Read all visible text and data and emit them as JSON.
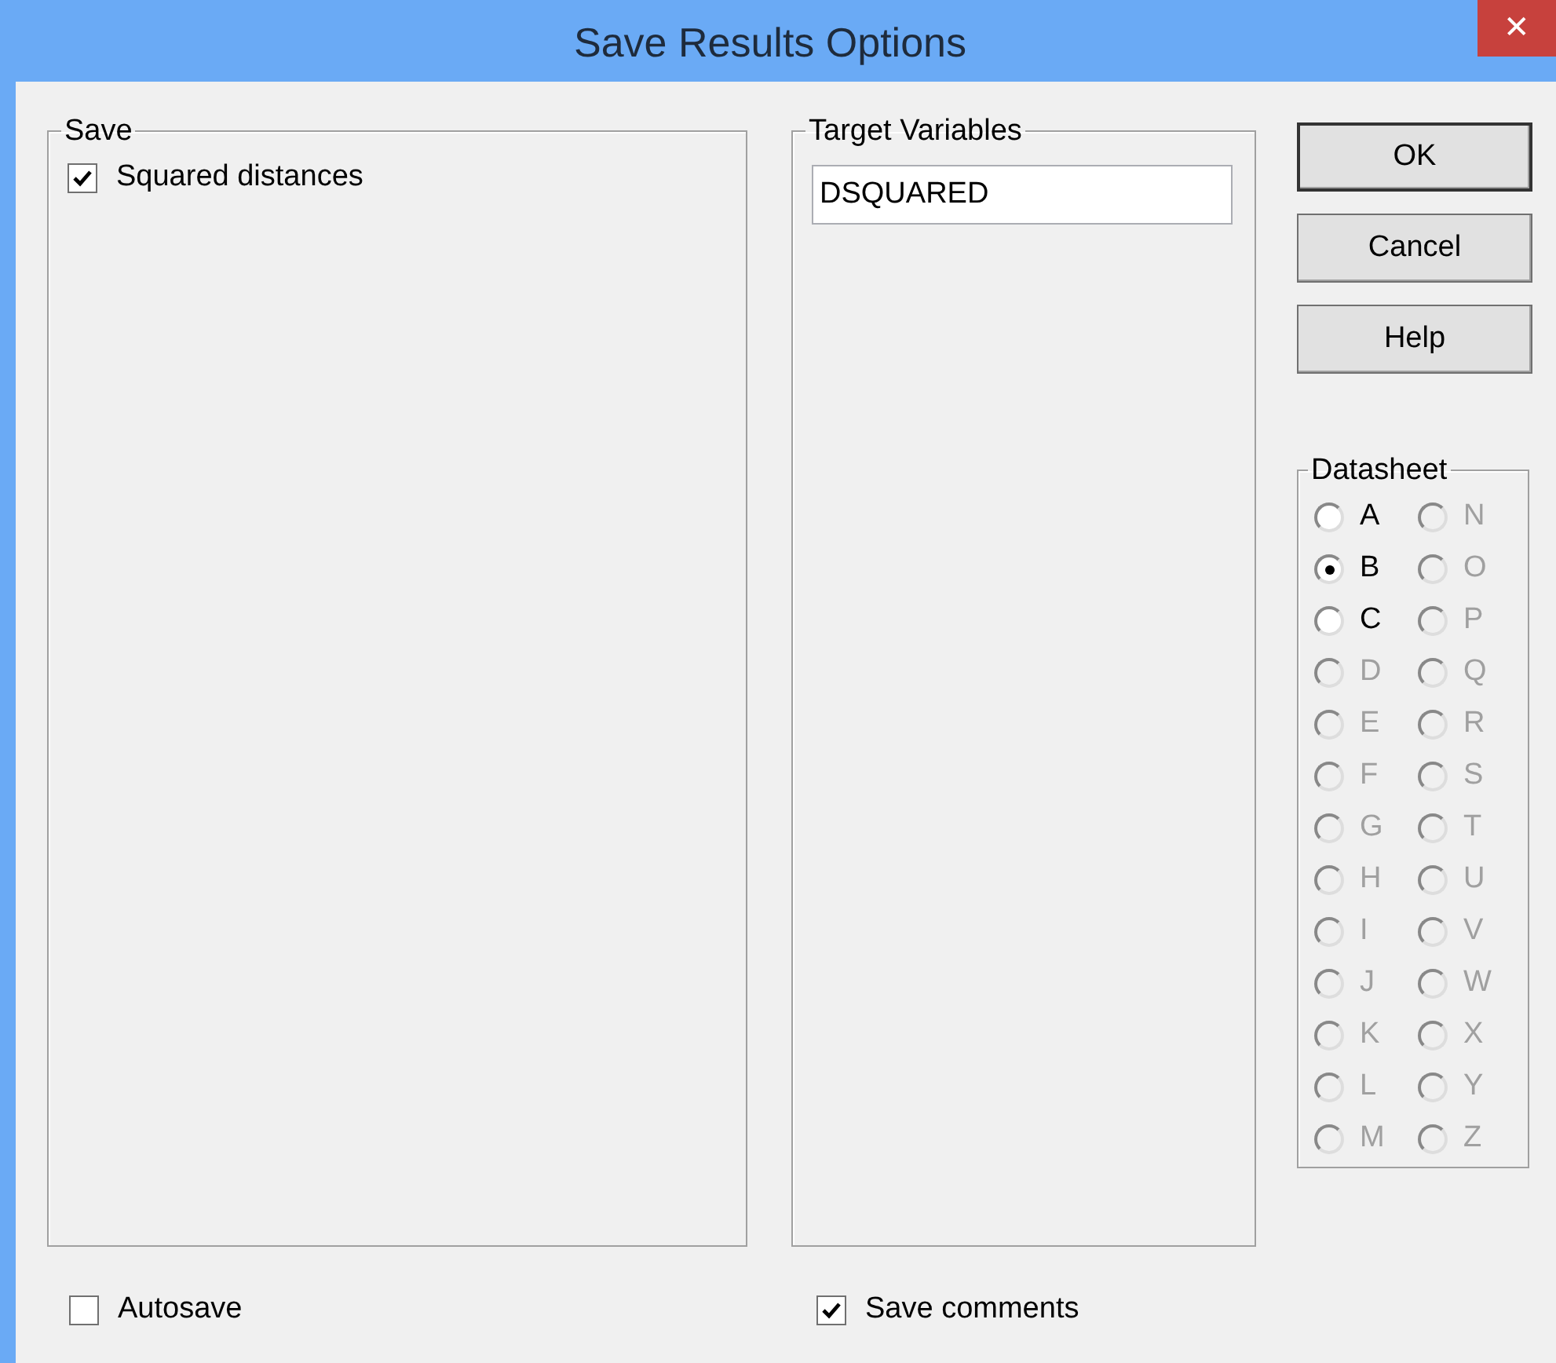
{
  "window": {
    "title": "Save Results Options",
    "close": "✕"
  },
  "save_group": {
    "label": "Save",
    "options": [
      {
        "label": "Squared distances",
        "checked": true
      }
    ]
  },
  "target_group": {
    "label": "Target Variables",
    "value": "DSQUARED"
  },
  "buttons": [
    "OK",
    "Cancel",
    "Help"
  ],
  "datasheet": {
    "label": "Datasheet",
    "options": [
      {
        "label": "A",
        "selected": false,
        "disabled": false
      },
      {
        "label": "B",
        "selected": true,
        "disabled": false
      },
      {
        "label": "C",
        "selected": false,
        "disabled": false
      },
      {
        "label": "D",
        "selected": false,
        "disabled": true
      },
      {
        "label": "E",
        "selected": false,
        "disabled": true
      },
      {
        "label": "F",
        "selected": false,
        "disabled": true
      },
      {
        "label": "G",
        "selected": false,
        "disabled": true
      },
      {
        "label": "H",
        "selected": false,
        "disabled": true
      },
      {
        "label": "I",
        "selected": false,
        "disabled": true
      },
      {
        "label": "J",
        "selected": false,
        "disabled": true
      },
      {
        "label": "K",
        "selected": false,
        "disabled": true
      },
      {
        "label": "L",
        "selected": false,
        "disabled": true
      },
      {
        "label": "M",
        "selected": false,
        "disabled": true
      },
      {
        "label": "N",
        "selected": false,
        "disabled": true
      },
      {
        "label": "O",
        "selected": false,
        "disabled": true
      },
      {
        "label": "P",
        "selected": false,
        "disabled": true
      },
      {
        "label": "Q",
        "selected": false,
        "disabled": true
      },
      {
        "label": "R",
        "selected": false,
        "disabled": true
      },
      {
        "label": "S",
        "selected": false,
        "disabled": true
      },
      {
        "label": "T",
        "selected": false,
        "disabled": true
      },
      {
        "label": "U",
        "selected": false,
        "disabled": true
      },
      {
        "label": "V",
        "selected": false,
        "disabled": true
      },
      {
        "label": "W",
        "selected": false,
        "disabled": true
      },
      {
        "label": "X",
        "selected": false,
        "disabled": true
      },
      {
        "label": "Y",
        "selected": false,
        "disabled": true
      },
      {
        "label": "Z",
        "selected": false,
        "disabled": true
      }
    ]
  },
  "bottom_options": [
    {
      "label": "Autosave",
      "checked": false
    },
    {
      "label": "Save comments",
      "checked": true
    }
  ]
}
